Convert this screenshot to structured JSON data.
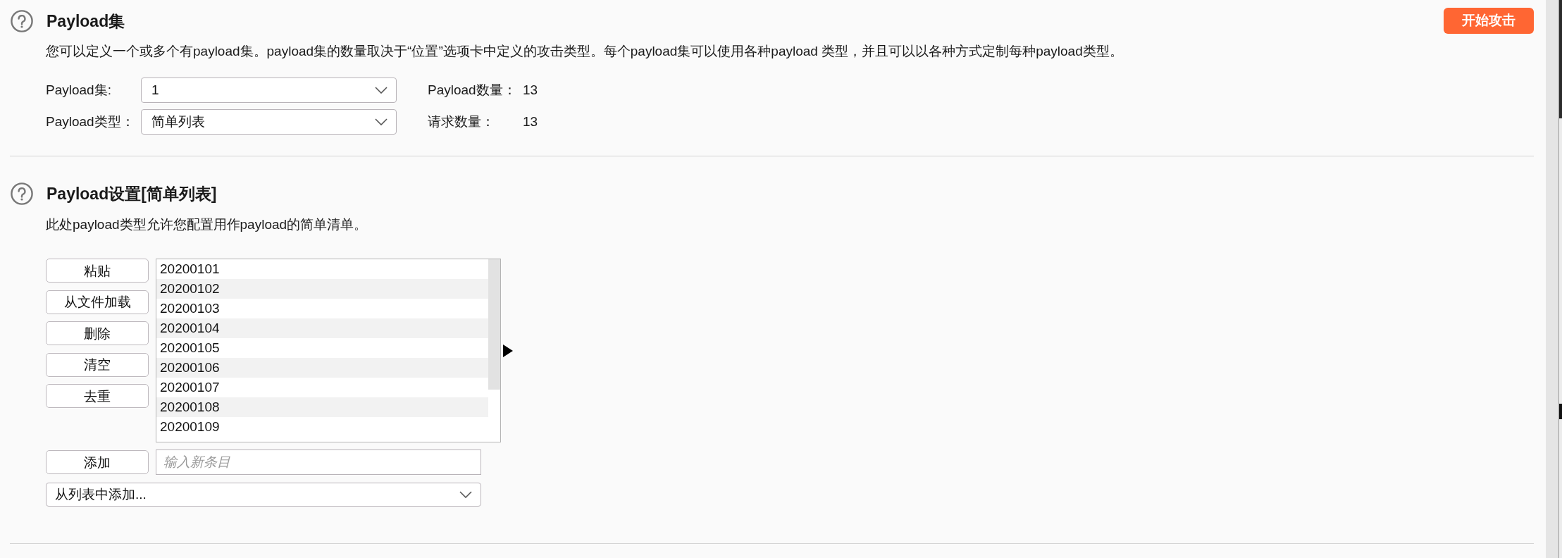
{
  "attack_button": {
    "label": "开始攻击"
  },
  "payload_sets": {
    "title": "Payload集",
    "description": "您可以定义一个或多个有payload集。payload集的数量取决于“位置”选项卡中定义的攻击类型。每个payload集可以使用各种payload 类型，并且可以以各种方式定制每种payload类型。",
    "fields": [
      {
        "label": "Payload集:",
        "value": "1"
      },
      {
        "label": "Payload类型：",
        "value": "简单列表"
      }
    ],
    "stats": [
      {
        "label": "Payload数量：",
        "value": "13"
      },
      {
        "label": "请求数量：",
        "value": "13"
      }
    ]
  },
  "payload_settings": {
    "title": "Payload设置[简单列表]",
    "description": "此处payload类型允许您配置用作payload的简单清单。",
    "buttons": [
      "粘贴",
      "从文件加载",
      "删除",
      "清空",
      "去重"
    ],
    "items": [
      {
        "text": "20200101",
        "selected": false
      },
      {
        "text": "20200102",
        "selected": false
      },
      {
        "text": "20200103",
        "selected": false
      },
      {
        "text": "20200104",
        "selected": false
      },
      {
        "text": "20200105",
        "selected": false
      },
      {
        "text": "20200106",
        "selected": false
      },
      {
        "text": "20200107",
        "selected": false
      },
      {
        "text": "20200108",
        "selected": false
      },
      {
        "text": "20200109",
        "selected": false
      }
    ],
    "add_button": "添加",
    "new_item": {
      "placeholder": "输入新条目"
    },
    "add_from_list": {
      "value": "从列表中添加..."
    }
  }
}
